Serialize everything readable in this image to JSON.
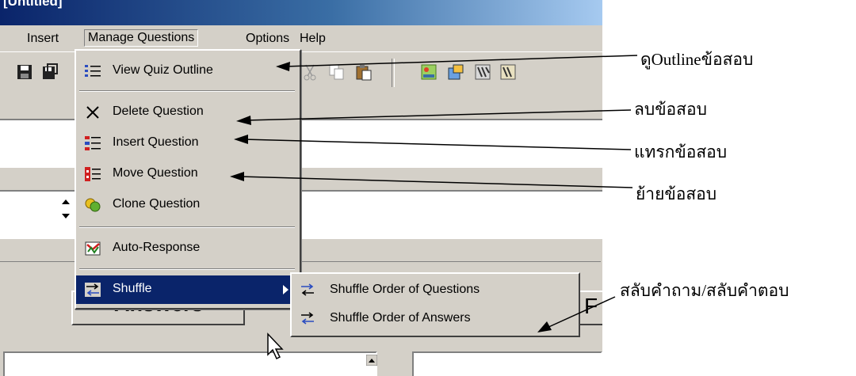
{
  "window": {
    "title": "[Untitled]",
    "doc_title_fragment": "tle"
  },
  "menubar": {
    "insert": "Insert",
    "manage_questions": "Manage Questions",
    "options": "Options",
    "help": "Help"
  },
  "manage_menu": {
    "items": [
      {
        "label": "View Quiz Outline",
        "icon": "outline-icon"
      },
      {
        "label": "Delete Question",
        "icon": "delete-x-icon"
      },
      {
        "label": "Insert Question",
        "icon": "insert-question-icon"
      },
      {
        "label": "Move Question",
        "icon": "move-question-icon"
      },
      {
        "label": "Clone Question",
        "icon": "clone-question-icon"
      },
      {
        "label": "Auto-Response",
        "icon": "auto-response-icon"
      },
      {
        "label": "Shuffle",
        "icon": "shuffle-icon"
      }
    ]
  },
  "shuffle_submenu": {
    "items": [
      {
        "label": "Shuffle Order of Questions",
        "icon": "shuffle-questions-icon"
      },
      {
        "label": "Shuffle Order of Answers",
        "icon": "shuffle-answers-icon"
      }
    ]
  },
  "panels": {
    "answers_button": "Answers",
    "f_button": "F"
  },
  "annotations": {
    "view_outline": "ดูOutlineข้อสอบ",
    "delete": "ลบข้อสอบ",
    "insert": "แทรกข้อสอบ",
    "move": "ย้ายข้อสอบ",
    "shuffle": "สลับคำถาม/สลับคำตอบ"
  },
  "colors": {
    "menu_highlight": "#0a246a",
    "face": "#d4d0c8"
  }
}
